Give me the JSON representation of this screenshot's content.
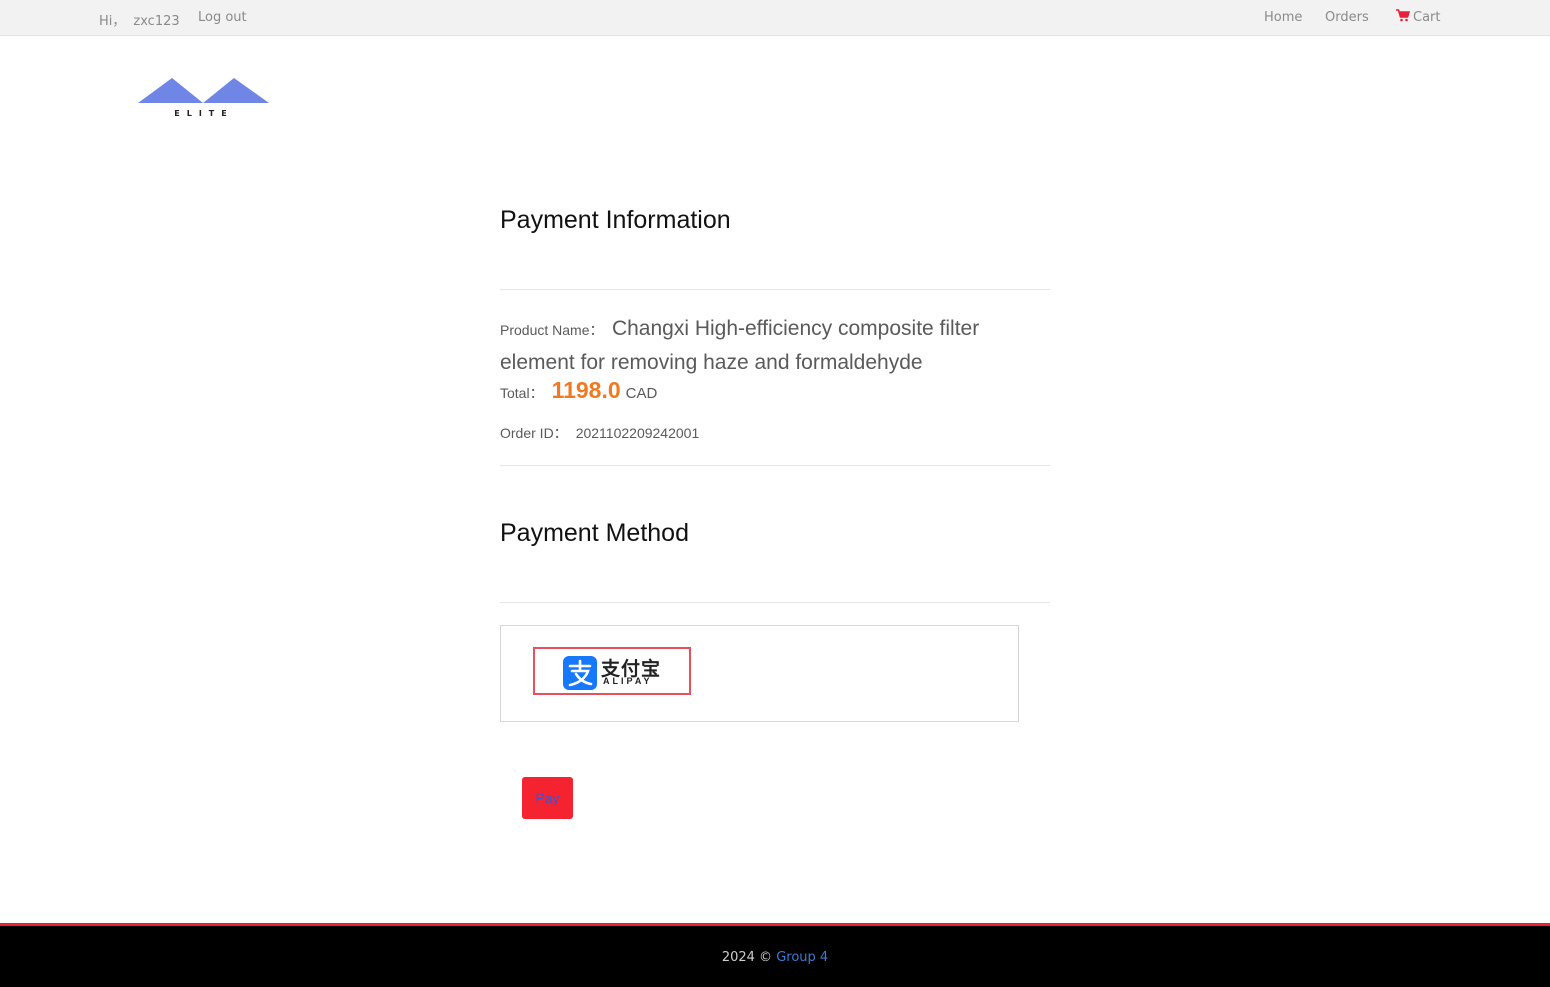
{
  "topbar": {
    "greeting": "Hi，",
    "username": "zxc123",
    "logout": "Log out",
    "nav": {
      "home": "Home",
      "orders": "Orders",
      "cart": "Cart"
    }
  },
  "logo": {
    "text": "ELITE",
    "color": "#6f86e6"
  },
  "payment_info": {
    "title": "Payment Information",
    "product_label": "Product Name：",
    "product_name": "Changxi High-efficiency composite filter element for removing haze and formaldehyde",
    "total_label": "Total：",
    "total_amount": "1198.0",
    "currency": "CAD",
    "order_label": "Order ID：",
    "order_id": "2021102209242001"
  },
  "payment_method": {
    "title": "Payment Method",
    "option": {
      "name_cn": "支付宝",
      "name_en": "ALIPAY",
      "selected": true
    }
  },
  "pay_button": "Pay",
  "footer": {
    "text": "2024 © ",
    "link": "Group 4"
  },
  "colors": {
    "accent_red": "#f5222f",
    "price_orange": "#f07a23",
    "link_blue": "#3a7bd5",
    "alipay_blue": "#1677ff"
  }
}
